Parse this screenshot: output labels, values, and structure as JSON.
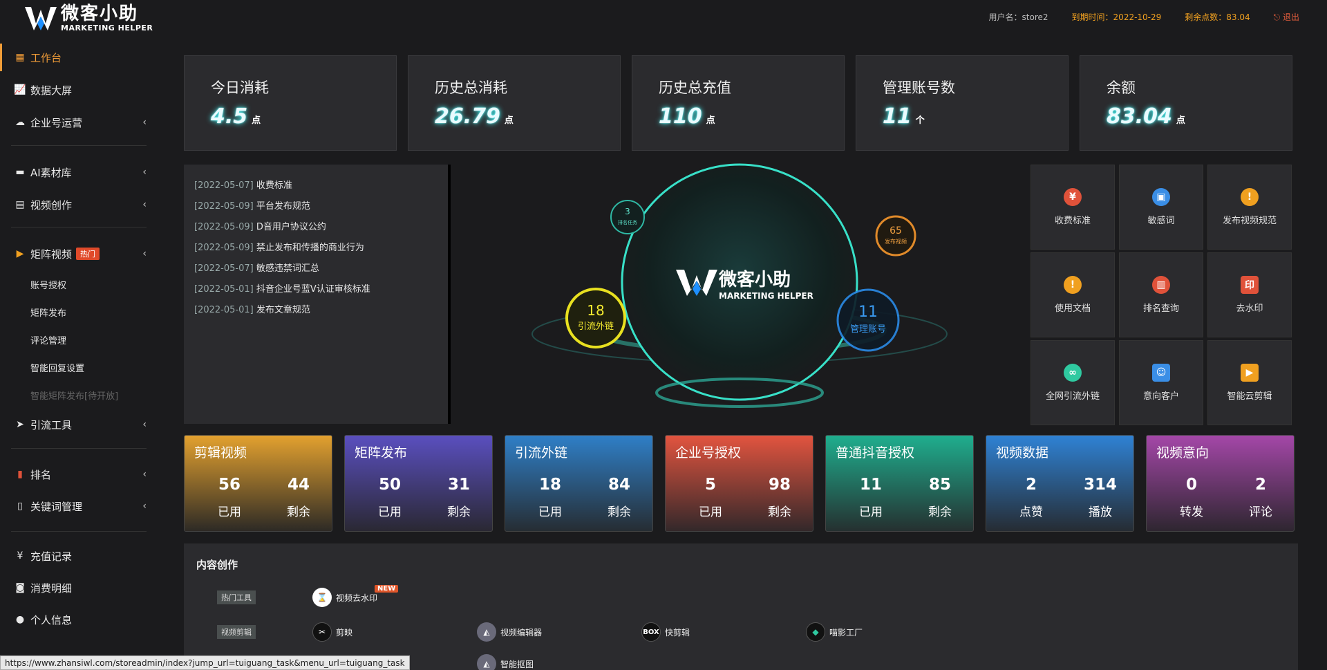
{
  "header": {
    "logo_cn": "微客小助",
    "logo_en": "MARKETING HELPER",
    "user": "用户名：store2",
    "expire": "到期时间：2022-10-29",
    "points": "剩余点数：83.04",
    "logout": "退出"
  },
  "sidebar": {
    "items": [
      {
        "label": "工作台",
        "icon": "grid-icon"
      },
      {
        "label": "数据大屏",
        "icon": "chart-icon"
      },
      {
        "label": "企业号运营",
        "icon": "cloud-icon"
      },
      {
        "label": "AI素材库",
        "icon": "folder-icon"
      },
      {
        "label": "视频创作",
        "icon": "film-icon"
      },
      {
        "label": "矩阵视频",
        "icon": "video-icon",
        "badge": "热门"
      },
      {
        "label": "引流工具",
        "icon": "send-icon"
      },
      {
        "label": "排名",
        "icon": "rank-icon"
      },
      {
        "label": "关键词管理",
        "icon": "doc-icon"
      },
      {
        "label": "充值记录",
        "icon": "yen-icon"
      },
      {
        "label": "消费明细",
        "icon": "money-icon"
      },
      {
        "label": "个人信息",
        "icon": "user-icon"
      }
    ],
    "sub_items": [
      "账号授权",
      "矩阵发布",
      "评论管理",
      "智能回复设置",
      "智能矩阵发布[待开放]"
    ]
  },
  "stats": [
    {
      "label": "今日消耗",
      "value": "4.5",
      "unit": "点"
    },
    {
      "label": "历史总消耗",
      "value": "26.79",
      "unit": "点"
    },
    {
      "label": "历史总充值",
      "value": "110",
      "unit": "点"
    },
    {
      "label": "管理账号数",
      "value": "11",
      "unit": "个"
    },
    {
      "label": "余额",
      "value": "83.04",
      "unit": "点"
    }
  ],
  "notices": [
    {
      "date": "[2022-05-07]",
      "title": "收费标准"
    },
    {
      "date": "[2022-05-09]",
      "title": "平台发布规范"
    },
    {
      "date": "[2022-05-09]",
      "title": "D音用户协议公约"
    },
    {
      "date": "[2022-05-09]",
      "title": "禁止发布和传播的商业行为"
    },
    {
      "date": "[2022-05-07]",
      "title": "敏感违禁词汇总"
    },
    {
      "date": "[2022-05-01]",
      "title": "抖音企业号蓝V认证审核标准"
    },
    {
      "date": "[2022-05-01]",
      "title": "发布文章规范"
    }
  ],
  "visual": {
    "logo_cn": "微客小助",
    "logo_en": "MARKETING HELPER",
    "bubble_rank": {
      "value": "3",
      "label": "排名任务"
    },
    "bubble_publish": {
      "value": "65",
      "label": "发布视频"
    },
    "bubble_link": {
      "value": "18",
      "label": "引流外链"
    },
    "bubble_accounts": {
      "value": "11",
      "label": "管理账号"
    }
  },
  "tiles": [
    {
      "label": "收费标准",
      "icon": "fee-icon",
      "color": "#e0523a"
    },
    {
      "label": "敏感词",
      "icon": "briefcase-icon",
      "color": "#3a8ee6"
    },
    {
      "label": "发布视频规范",
      "icon": "warning-icon",
      "color": "#f0a020"
    },
    {
      "label": "使用文档",
      "icon": "warning-icon",
      "color": "#f0a020"
    },
    {
      "label": "排名查询",
      "icon": "bar-chart-icon",
      "color": "#e0523a"
    },
    {
      "label": "去水印",
      "icon": "stamp-icon",
      "color": "#e0523a"
    },
    {
      "label": "全网引流外链",
      "icon": "link-icon",
      "color": "#2fc9a0"
    },
    {
      "label": "意向客户",
      "icon": "person-icon",
      "color": "#3a8ee6"
    },
    {
      "label": "智能云剪辑",
      "icon": "camera-icon",
      "color": "#f0a020"
    }
  ],
  "features": [
    {
      "title": "剪辑视频",
      "a": "56",
      "a_label": "已用",
      "b": "44",
      "b_label": "剩余",
      "color": "#e3a12f"
    },
    {
      "title": "矩阵发布",
      "a": "50",
      "a_label": "已用",
      "b": "31",
      "b_label": "剩余",
      "color": "#5a4fbf"
    },
    {
      "title": "引流外链",
      "a": "18",
      "a_label": "已用",
      "b": "84",
      "b_label": "剩余",
      "color": "#2f7fc7"
    },
    {
      "title": "企业号授权",
      "a": "5",
      "a_label": "已用",
      "b": "98",
      "b_label": "剩余",
      "color": "#e2543f"
    },
    {
      "title": "普通抖音授权",
      "a": "11",
      "a_label": "已用",
      "b": "85",
      "b_label": "剩余",
      "color": "#1fae8e"
    },
    {
      "title": "视频数据",
      "a": "2",
      "a_label": "点赞",
      "b": "314",
      "b_label": "播放",
      "color": "#2f82d4"
    },
    {
      "title": "视频意向",
      "a": "0",
      "a_label": "转发",
      "b": "2",
      "b_label": "评论",
      "color": "#a447a8"
    }
  ],
  "content": {
    "title": "内容创作",
    "tag_hot": "热门工具",
    "tag_edit": "视频剪辑",
    "tools": [
      {
        "label": "视频去水印",
        "badge": "NEW"
      },
      {
        "label": "剪映"
      },
      {
        "label": "视频编辑器"
      },
      {
        "label": "快剪辑"
      },
      {
        "label": "喵影工厂"
      },
      {
        "label": "智能抠图"
      }
    ]
  },
  "status_url": "https://www.zhansiwl.com/storeadmin/index?jump_url=tuiguang_task&menu_url=tuiguang_task"
}
